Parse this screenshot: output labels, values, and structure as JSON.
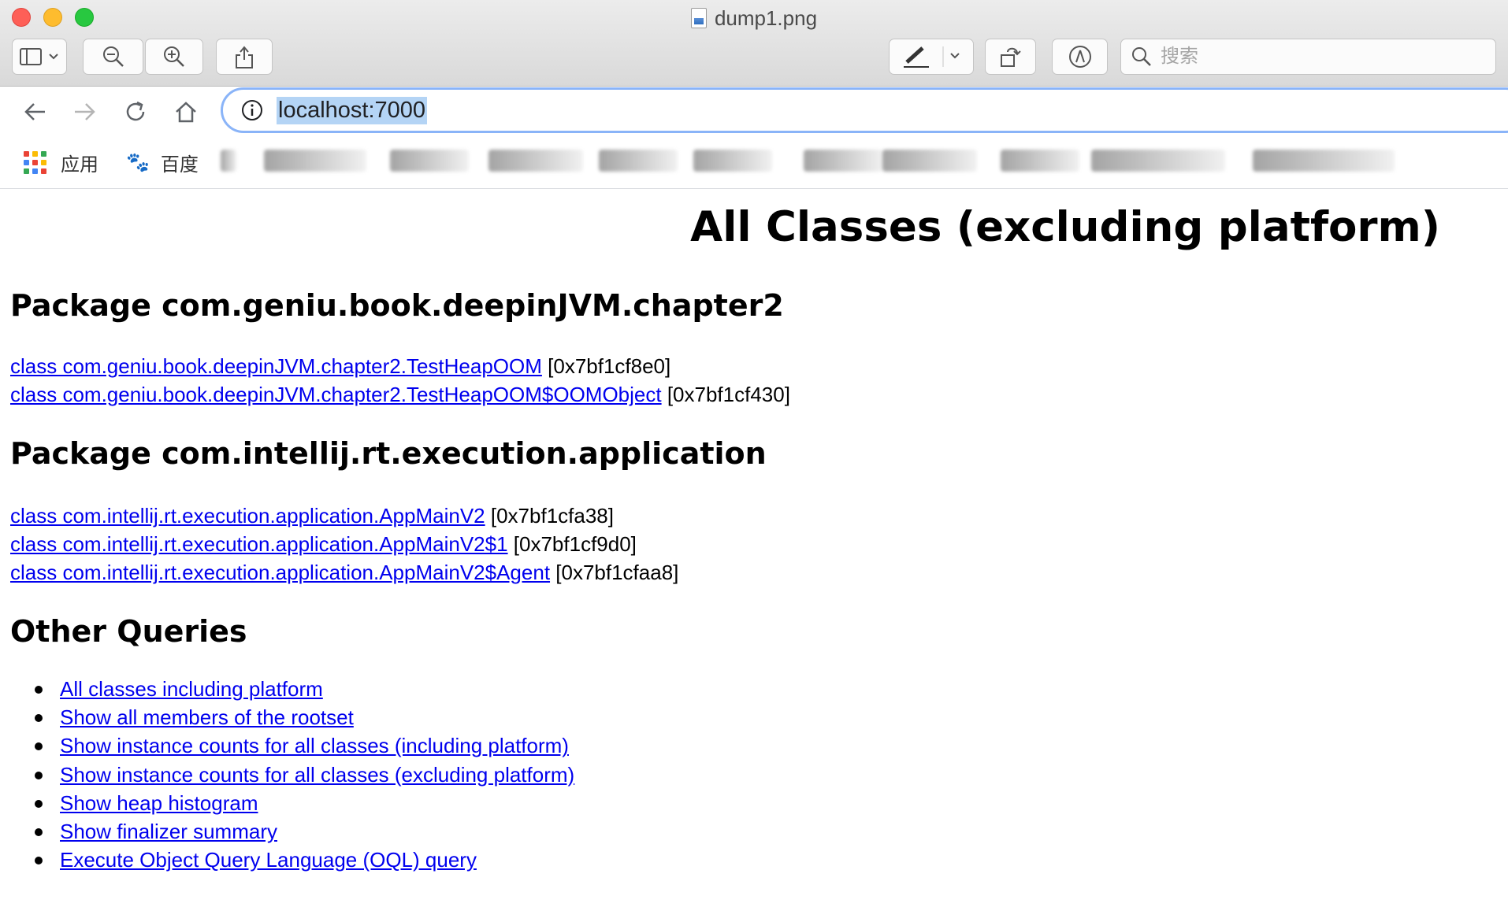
{
  "window": {
    "title": "dump1.png",
    "search_placeholder": "搜索"
  },
  "browser": {
    "url": "localhost:7000",
    "bookmarks": {
      "apps_label": "应用",
      "baidu_label": "百度"
    }
  },
  "page": {
    "title": "All Classes (excluding platform)",
    "packages": [
      {
        "heading": "Package com.geniu.book.deepinJVM.chapter2",
        "classes": [
          {
            "link": "class com.geniu.book.deepinJVM.chapter2.TestHeapOOM",
            "addr": " [0x7bf1cf8e0]"
          },
          {
            "link": "class com.geniu.book.deepinJVM.chapter2.TestHeapOOM$OOMObject",
            "addr": " [0x7bf1cf430]"
          }
        ]
      },
      {
        "heading": "Package com.intellij.rt.execution.application",
        "classes": [
          {
            "link": "class com.intellij.rt.execution.application.AppMainV2",
            "addr": " [0x7bf1cfa38]"
          },
          {
            "link": "class com.intellij.rt.execution.application.AppMainV2$1",
            "addr": " [0x7bf1cf9d0]"
          },
          {
            "link": "class com.intellij.rt.execution.application.AppMainV2$Agent",
            "addr": " [0x7bf1cfaa8]"
          }
        ]
      }
    ],
    "other_queries_heading": "Other Queries",
    "other_queries": [
      "All classes including platform",
      "Show all members of the rootset",
      "Show instance counts for all classes (including platform)",
      "Show instance counts for all classes (excluding platform)",
      "Show heap histogram",
      "Show finalizer summary",
      "Execute Object Query Language (OQL) query"
    ]
  },
  "colors": {
    "link": "#0000ee",
    "url_highlight": "#b4d4f5",
    "omnibox_focus": "#8ab4f8"
  }
}
